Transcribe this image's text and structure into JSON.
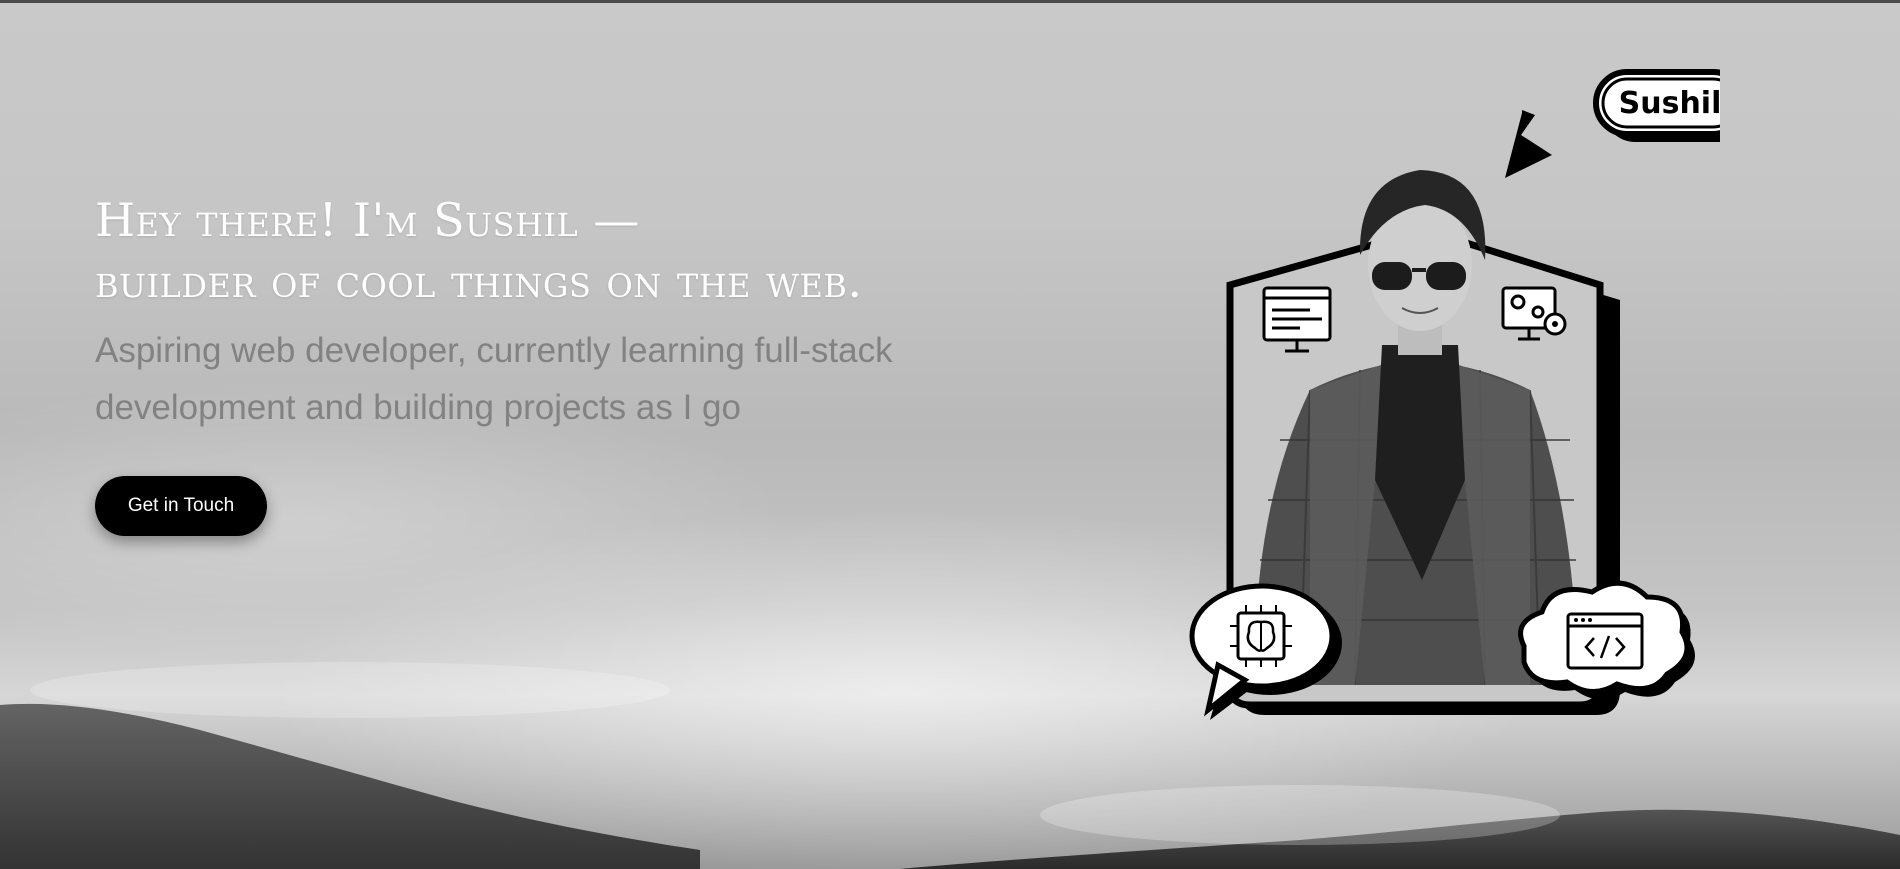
{
  "hero": {
    "headline_line1": "Hey there! I'm Sushil —",
    "headline_line2": "builder of cool things on the web.",
    "subtitle_line1": "Aspiring web developer, currently learning full-stack",
    "subtitle_line2": "development and building projects as I go",
    "cta_label": "Get in Touch"
  },
  "avatar": {
    "name_badge": "Sushil",
    "icons": [
      "code-window-icon",
      "monitor-settings-icon",
      "brain-chip-icon",
      "code-browser-icon",
      "arrow-pointer-icon"
    ]
  },
  "colors": {
    "headline": "#ffffff",
    "subtitle": "#828282",
    "button_bg": "#000000",
    "button_text": "#ffffff"
  }
}
